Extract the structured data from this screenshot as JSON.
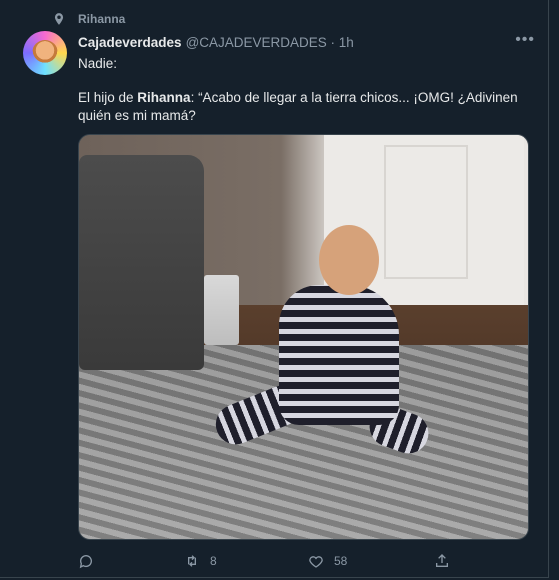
{
  "context": {
    "label": "Rihanna"
  },
  "tweet": {
    "display_name": "Cajadeverdades",
    "handle_time": "@CAJADEVERDADES · 1h",
    "more": "•••",
    "line1": "Nadie:",
    "line2_prefix": "El hijo de ",
    "line2_name": "Rihanna",
    "line2_rest": ": “Acabo de llegar a la tierra chicos... ¡OMG! ¿Adivinen quién es mi mamá?"
  },
  "actions": {
    "retweets": "8",
    "likes": "58"
  },
  "colors": {
    "background": "#15202b",
    "text": "#e7e9ea",
    "muted": "#8b98a5",
    "border": "#38444d"
  }
}
